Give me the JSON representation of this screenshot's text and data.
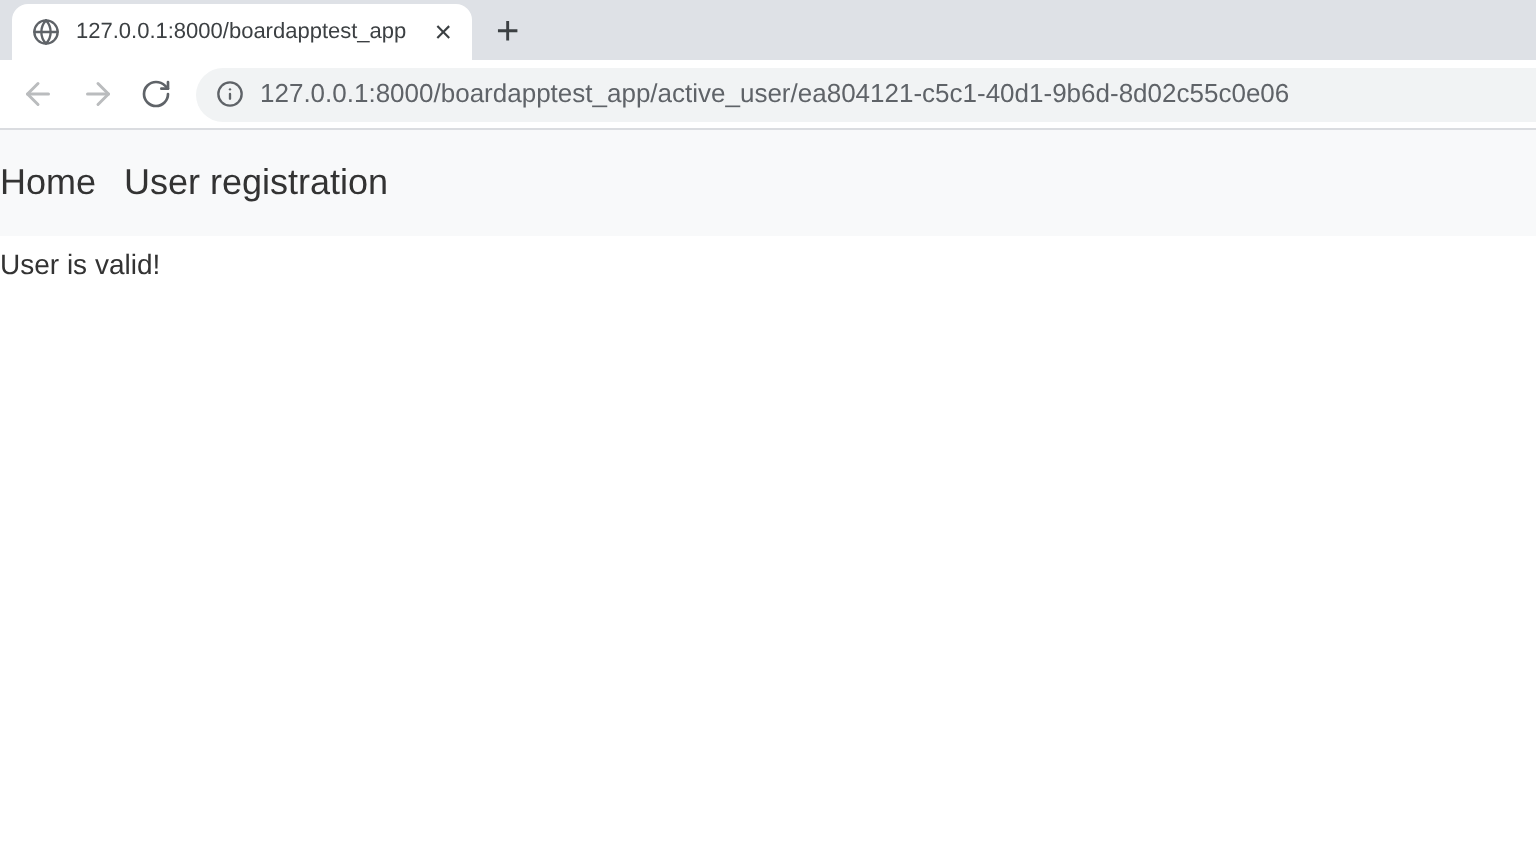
{
  "tab": {
    "title": "127.0.0.1:8000/boardapptest_app",
    "close": "×",
    "new_tab": "+"
  },
  "address_bar": {
    "url": "127.0.0.1:8000/boardapptest_app/active_user/ea804121-c5c1-40d1-9b6d-8d02c55c0e06"
  },
  "navbar": {
    "links": [
      "Home",
      "User registration"
    ]
  },
  "message": "User is valid!"
}
